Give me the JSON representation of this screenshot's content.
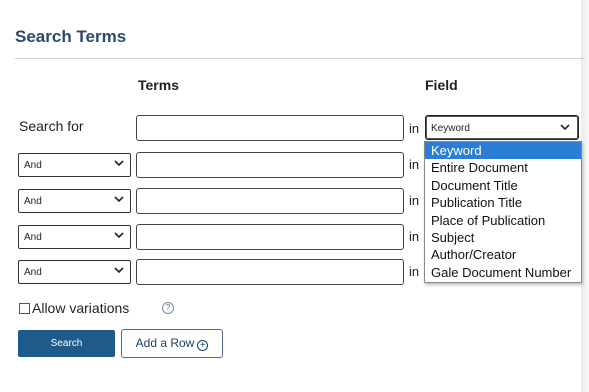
{
  "title": "Search Terms",
  "headers": {
    "terms": "Terms",
    "field": "Field"
  },
  "search_for_label": "Search for",
  "in_label": "in",
  "rows": [
    {
      "operator": "And"
    },
    {
      "operator": "And"
    },
    {
      "operator": "And"
    },
    {
      "operator": "And"
    }
  ],
  "field_select": {
    "value": "Keyword"
  },
  "field_options": [
    "Keyword",
    "Entire Document",
    "Document Title",
    "Publication Title",
    "Place of Publication",
    "Subject",
    "Author/Creator",
    "Gale Document Number"
  ],
  "allow_variations": "Allow variations",
  "help_glyph": "?",
  "buttons": {
    "search": "Search",
    "add_row": "Add a Row",
    "add_row_icon": "+"
  },
  "colors": {
    "title": "#2b4a6b",
    "search_button": "#1e5a8a",
    "selected_option": "#2a7ed6"
  },
  "icons": [
    "chevron-down-icon",
    "help-circle-icon",
    "plus-circle-icon",
    "checkbox-icon"
  ]
}
